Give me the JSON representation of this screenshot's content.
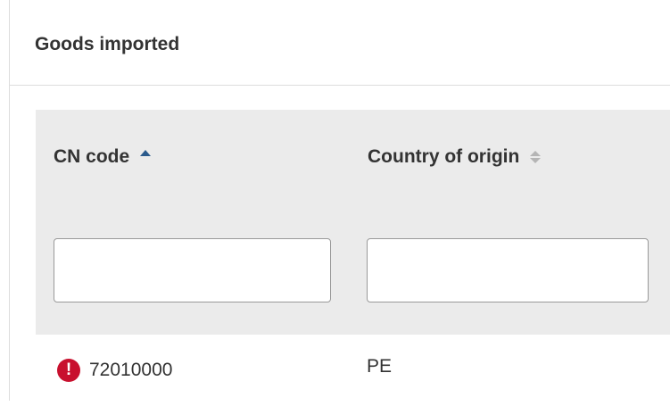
{
  "panel": {
    "title": "Goods imported"
  },
  "table": {
    "columns": [
      {
        "label": "CN code",
        "sort": "ascending",
        "sort_icon": "sort-asc-icon"
      },
      {
        "label": "Country of origin",
        "sort": "none",
        "sort_icon": "sort-both-icon"
      }
    ],
    "filters": [
      {
        "value": "",
        "placeholder": ""
      },
      {
        "value": "",
        "placeholder": ""
      }
    ],
    "rows": [
      {
        "status_icon": "error-icon",
        "status_glyph": "!",
        "cn_code": "72010000",
        "country": "PE"
      }
    ]
  },
  "colors": {
    "accent": "#2a5a8c",
    "error": "#c8102e",
    "header_bg": "#ebebeb",
    "text": "#333333"
  }
}
